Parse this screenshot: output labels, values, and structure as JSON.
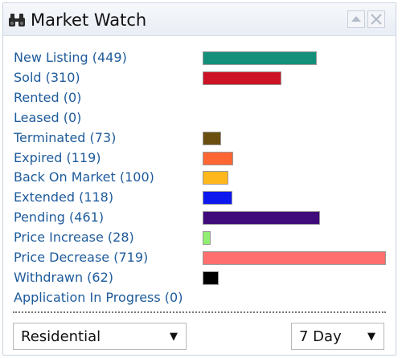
{
  "widget": {
    "title": "Market Watch",
    "icon": "binoculars-icon",
    "buttons": [
      {
        "name": "collapse-icon",
        "glyph": "▲"
      },
      {
        "name": "close-icon",
        "glyph": "✕"
      }
    ]
  },
  "listings": [
    {
      "label": "New Listing (449)",
      "count": 449,
      "color": "#14907a"
    },
    {
      "label": "Sold (310)",
      "count": 310,
      "color": "#cc1426"
    },
    {
      "label": "Rented (0)",
      "count": 0,
      "color": null
    },
    {
      "label": "Leased (0)",
      "count": 0,
      "color": null
    },
    {
      "label": "Terminated (73)",
      "count": 73,
      "color": "#6a4f10"
    },
    {
      "label": "Expired (119)",
      "count": 119,
      "color": "#ff6633"
    },
    {
      "label": "Back On Market (100)",
      "count": 100,
      "color": "#ffb81c"
    },
    {
      "label": "Extended (118)",
      "count": 118,
      "color": "#0d18ee"
    },
    {
      "label": "Pending (461)",
      "count": 461,
      "color": "#3f0a7a"
    },
    {
      "label": "Price Increase (28)",
      "count": 28,
      "color": "#90ee70"
    },
    {
      "label": "Price Decrease (719)",
      "count": 719,
      "color": "#ff6f6f"
    },
    {
      "label": "Withdrawn (62)",
      "count": 62,
      "color": "#000000"
    },
    {
      "label": "Application In Progress (0)",
      "count": 0,
      "color": null
    }
  ],
  "filters": {
    "property_type": "Residential",
    "period": "7 Day",
    "dropdown_glyph": "▼"
  }
}
